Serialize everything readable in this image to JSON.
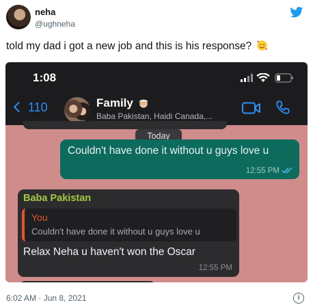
{
  "tweet": {
    "display_name": "neha",
    "handle": "@ughneha",
    "text": "told my dad i got a new job and this is his response?",
    "emoji": "smiling-face-with-hearts",
    "timestamp": "6:02 AM · Jun 8, 2021",
    "brand_color": "#1d9bf0"
  },
  "screenshot": {
    "status": {
      "time": "1:08"
    },
    "header": {
      "back_count": "110",
      "group_name": "Family",
      "group_members": "Baba Pakistan, Haidi Canada,...",
      "accent_color": "#2a8ff7"
    },
    "date_divider": "Today",
    "outgoing": {
      "text": "Couldn't have done it without u guys love u",
      "time": "12:55 PM"
    },
    "incoming": {
      "sender": "Baba Pakistan",
      "quoted_sender": "You",
      "quoted_text": "Couldn't have done it without u guys love u",
      "text": "Relax Neha u haven't won the Oscar",
      "time": "12:55 PM"
    }
  }
}
